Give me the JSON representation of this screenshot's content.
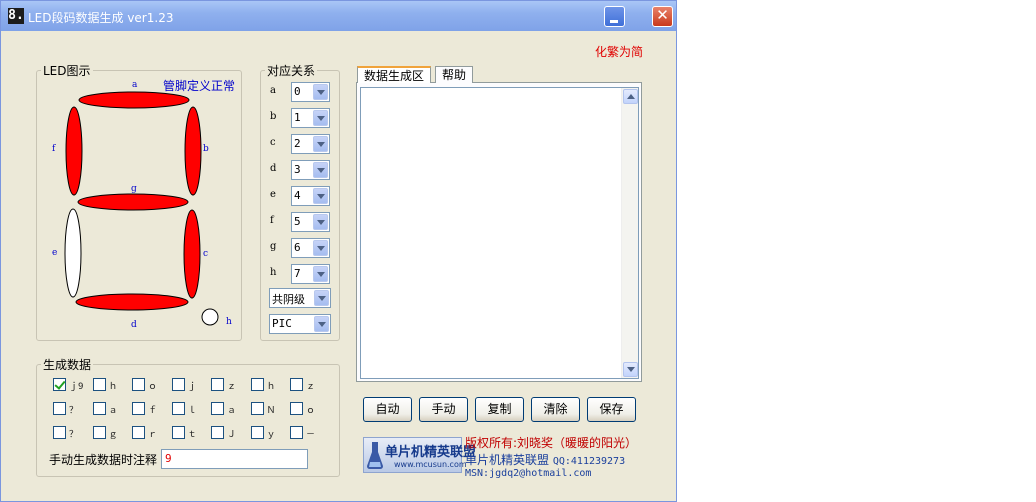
{
  "window": {
    "icon_glyph": "8.",
    "title": "LED段码数据生成 ver1.23",
    "minimize_icon": "minimize-icon",
    "close_icon": "close-icon",
    "close_glyph": "✕"
  },
  "simplify_link": "化繁为简",
  "led_panel": {
    "legend": "LED图示",
    "pin_note": "管脚定义正常",
    "segments": [
      {
        "id": "a",
        "lit": true
      },
      {
        "id": "b",
        "lit": true
      },
      {
        "id": "c",
        "lit": true
      },
      {
        "id": "d",
        "lit": true
      },
      {
        "id": "e",
        "lit": false
      },
      {
        "id": "f",
        "lit": true
      },
      {
        "id": "g",
        "lit": true
      },
      {
        "id": "h",
        "lit": false
      }
    ],
    "colors": {
      "lit": "#ff0000",
      "unlit": "#ffffff",
      "label": "#0000cc"
    }
  },
  "mapping": {
    "legend": "对应关系",
    "rows": [
      {
        "label": "a",
        "value": "0"
      },
      {
        "label": "b",
        "value": "1"
      },
      {
        "label": "c",
        "value": "2"
      },
      {
        "label": "d",
        "value": "3"
      },
      {
        "label": "e",
        "value": "4"
      },
      {
        "label": "f",
        "value": "5"
      },
      {
        "label": "g",
        "value": "6"
      },
      {
        "label": "h",
        "value": "7"
      }
    ],
    "cathode_select": "共阴级",
    "target_select": "PIC"
  },
  "generate": {
    "legend": "生成数据",
    "rows": [
      [
        {
          "label": "ｊ9",
          "checked": true
        },
        {
          "label": "ｈ",
          "checked": false
        },
        {
          "label": "ｏ",
          "checked": false
        },
        {
          "label": "ｊ",
          "checked": false
        },
        {
          "label": "ｚ",
          "checked": false
        },
        {
          "label": "ｈ",
          "checked": false
        },
        {
          "label": "ｚ",
          "checked": false
        }
      ],
      [
        {
          "label": "？",
          "checked": false
        },
        {
          "label": "ａ",
          "checked": false
        },
        {
          "label": "ｆ",
          "checked": false
        },
        {
          "label": "ｌ",
          "checked": false
        },
        {
          "label": "ａ",
          "checked": false
        },
        {
          "label": "Ｎ",
          "checked": false
        },
        {
          "label": "ｏ",
          "checked": false
        }
      ],
      [
        {
          "label": "？",
          "checked": false
        },
        {
          "label": "ｇ",
          "checked": false
        },
        {
          "label": "ｒ",
          "checked": false
        },
        {
          "label": "ｔ",
          "checked": false
        },
        {
          "label": "Ｊ",
          "checked": false
        },
        {
          "label": "ｙ",
          "checked": false
        },
        {
          "label": "－",
          "checked": false
        }
      ]
    ],
    "note_label": "手动生成数据时注释",
    "note_value": "9"
  },
  "tabs": [
    {
      "label": "数据生成区",
      "active": true
    },
    {
      "label": "帮助",
      "active": false
    }
  ],
  "output_text": "",
  "buttons": {
    "auto": "自动",
    "manual": "手动",
    "copy": "复制",
    "clear": "清除",
    "save": "保存"
  },
  "logo": {
    "title": "单片机精英联盟",
    "url": "www.mcusun.com"
  },
  "credits": {
    "copyright": "版权所有:刘晓奖（暖暖的阳光）",
    "group": "单片机精英联盟",
    "qq": "QQ:411239273",
    "msn": "MSN:jgdq2@hotmail.com"
  }
}
